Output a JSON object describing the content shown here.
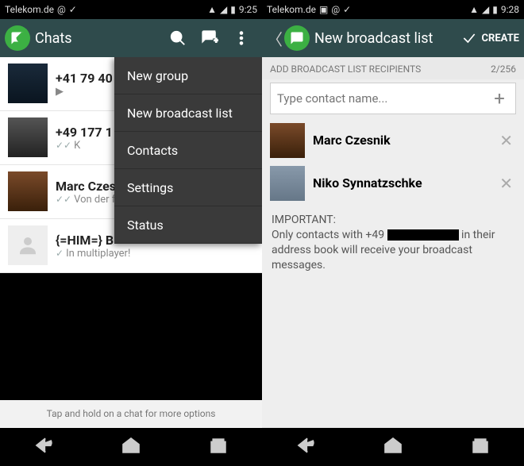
{
  "left": {
    "status": {
      "carrier": "Telekom.de",
      "time": "9:25"
    },
    "actionbar": {
      "title": "Chats"
    },
    "menu": [
      "New group",
      "New broadcast list",
      "Contacts",
      "Settings",
      "Status"
    ],
    "chats": [
      {
        "name": "+41 79 40",
        "preview": "▶"
      },
      {
        "name": "+49 177 1",
        "preview": "K",
        "ticks": "✓✓"
      },
      {
        "name": "Marc Czes",
        "preview": "Von der f",
        "ticks": "✓✓"
      },
      {
        "name": "{=HIM=} B",
        "preview": "In multiplayer!",
        "ticks": "✓"
      }
    ],
    "hint": "Tap and hold on a chat for more options"
  },
  "right": {
    "status": {
      "carrier": "Telekom.de",
      "time": "9:28"
    },
    "actionbar": {
      "title": "New broadcast list",
      "create": "CREATE"
    },
    "section_label": "ADD BROADCAST LIST RECIPIENTS",
    "count": "2/256",
    "input_placeholder": "Type contact name...",
    "contacts": [
      {
        "name": "Marc Czesnik"
      },
      {
        "name": "Niko Synnatzschke"
      }
    ],
    "important": {
      "head": "IMPORTANT:",
      "line1": "Only contacts with +49",
      "line2": "in their address book will receive your broadcast messages."
    }
  }
}
